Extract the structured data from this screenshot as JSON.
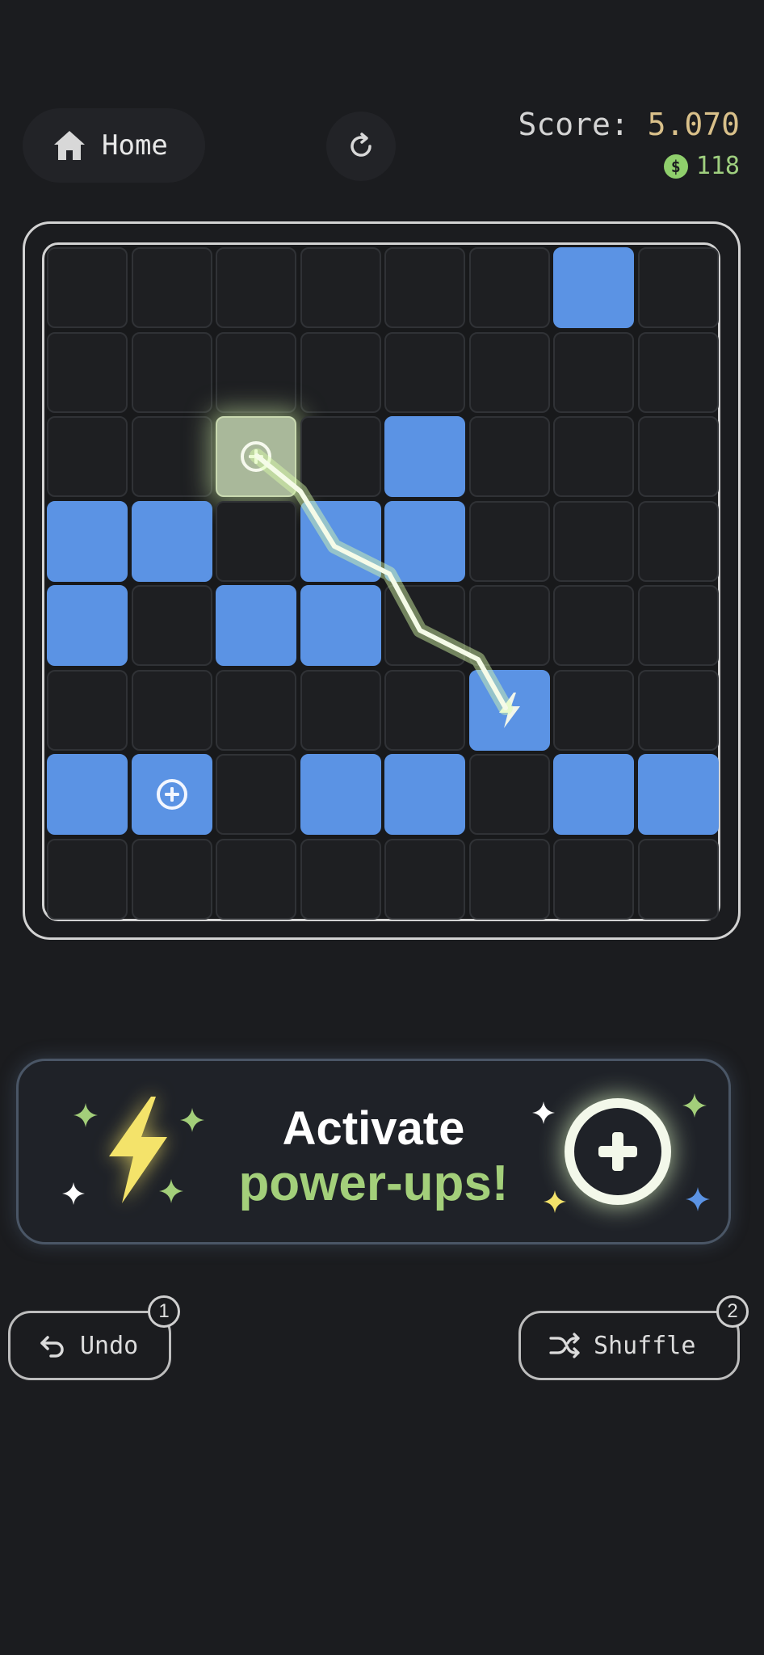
{
  "header": {
    "home_label": "Home",
    "score_label": "Score:",
    "score_value": "5.070",
    "coin_symbol": "$",
    "coins": "118"
  },
  "board": {
    "rows": 8,
    "cols": 8,
    "cells": [
      [
        "empty",
        "empty",
        "empty",
        "empty",
        "empty",
        "empty",
        "blue",
        "empty"
      ],
      [
        "empty",
        "empty",
        "empty",
        "empty",
        "empty",
        "empty",
        "empty",
        "empty"
      ],
      [
        "empty",
        "empty",
        "plus-glow",
        "empty",
        "blue",
        "empty",
        "empty",
        "empty"
      ],
      [
        "blue",
        "blue",
        "empty",
        "blue",
        "blue",
        "empty",
        "empty",
        "empty"
      ],
      [
        "blue",
        "empty",
        "blue",
        "blue",
        "empty",
        "empty",
        "empty",
        "empty"
      ],
      [
        "empty",
        "empty",
        "empty",
        "empty",
        "empty",
        "bolt",
        "empty",
        "empty"
      ],
      [
        "blue",
        "plus",
        "empty",
        "blue",
        "blue",
        "empty",
        "blue",
        "blue"
      ],
      [
        "empty",
        "empty",
        "empty",
        "empty",
        "empty",
        "empty",
        "empty",
        "empty"
      ]
    ]
  },
  "banner": {
    "line1": "Activate",
    "line2": "power-ups!"
  },
  "actions": {
    "undo_label": "Undo",
    "undo_count": "1",
    "shuffle_label": "Shuffle",
    "shuffle_count": "2"
  },
  "colors": {
    "background": "#1b1c1f",
    "tile_blue": "#5b93e4",
    "accent_green": "#a3cf7a",
    "score_gold": "#d9c08a",
    "bolt_yellow": "#f4e36a"
  }
}
